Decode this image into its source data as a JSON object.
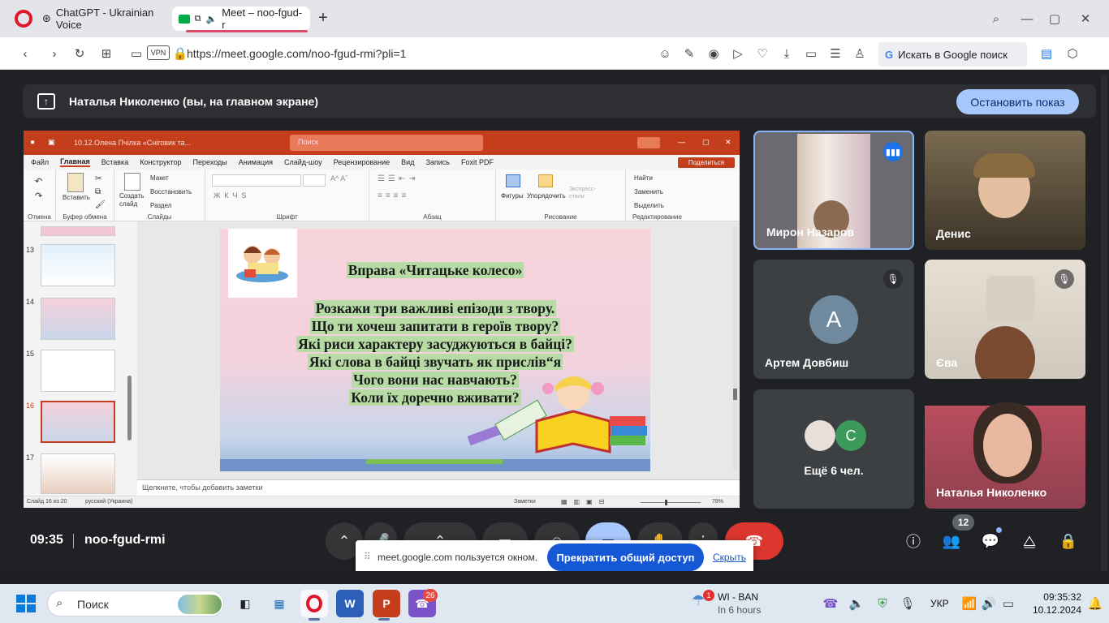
{
  "browser": {
    "tabs": [
      {
        "label": "ChatGPT - Ukrainian Voice"
      },
      {
        "label": "Meet – noo-fgud-r"
      }
    ],
    "new_tab": "+",
    "url": "https://meet.google.com/noo-fgud-rmi?pli=1",
    "vpn": "VPN",
    "search_label": "Искать в Google поиск"
  },
  "meet": {
    "presenting_text": "Наталья Николенко (вы, на главном экране)",
    "stop_label": "Остановить показ",
    "time": "09:35",
    "meeting_code": "noo-fgud-rmi",
    "participants_count": "12",
    "more_label": "Ещё 6 чел.",
    "avatar_a": "A",
    "avatar_c": "C",
    "participants": [
      {
        "name": "Мирон Назаров"
      },
      {
        "name": "Денис"
      },
      {
        "name": "Артем Довбиш"
      },
      {
        "name": "Єва"
      },
      {
        "name": "Наталья Николенко"
      }
    ]
  },
  "popup": {
    "text": "meet.google.com пользуется окном.",
    "share_label": "Прекратить общий доступ",
    "hide_label": "Скрыть"
  },
  "ppt": {
    "title": "10.12.Олена Пчілка «Сніговик та...",
    "search": "Поиск",
    "share": "Поделиться",
    "menu": [
      "Файл",
      "Главная",
      "Вставка",
      "Конструктор",
      "Переходы",
      "Анимация",
      "Слайд-шоу",
      "Рецензирование",
      "Вид",
      "Запись",
      "Foxit PDF"
    ],
    "groups": [
      "Отмена",
      "Буфер обмена",
      "Слайды",
      "Шрифт",
      "Абзац",
      "Рисование",
      "Редактирование"
    ],
    "ribbon": {
      "paste": "Вставить",
      "create": "Создать слайд",
      "layout": "Макет",
      "reset": "Восстановить",
      "section": "Раздел",
      "shapes": "Фигуры",
      "arrange": "Упорядочить",
      "express": "Экспресс-стили",
      "find": "Найти",
      "replace": "Заменить",
      "select": "Выделить"
    },
    "slide_numbers": [
      "13",
      "14",
      "15",
      "16",
      "17"
    ],
    "notes": "Щелкните, чтобы добавить заметки",
    "status_slide": "Слайд 16 из 20",
    "status_lang": "русский (Украина)",
    "status_notes": "Заметки",
    "zoom": "78%",
    "slide": {
      "title": "Вправа «Читацьке колесо»",
      "lines": [
        "Розкажи три важливі епізоди з твору.",
        "Що ти хочеш запитати в героїв твору?",
        "Які риси характеру засуджуються в байці?",
        "Які слова в байці звучать як прислів“я",
        "Чого вони нас навчають?",
        "Коли їх доречно вживати?"
      ]
    }
  },
  "taskbar": {
    "search": "Поиск",
    "badge_viber": "26",
    "weather_badge": "1",
    "weather_title": "WI - BAN",
    "weather_sub": "In 6 hours",
    "lang": "УКР",
    "time": "09:35:32",
    "date": "10.12.2024"
  },
  "colors": {
    "accent": "#a8c7fa",
    "ppt": "#c43e1c",
    "share_btn": "#1558d6",
    "hangup": "#dc362e"
  }
}
